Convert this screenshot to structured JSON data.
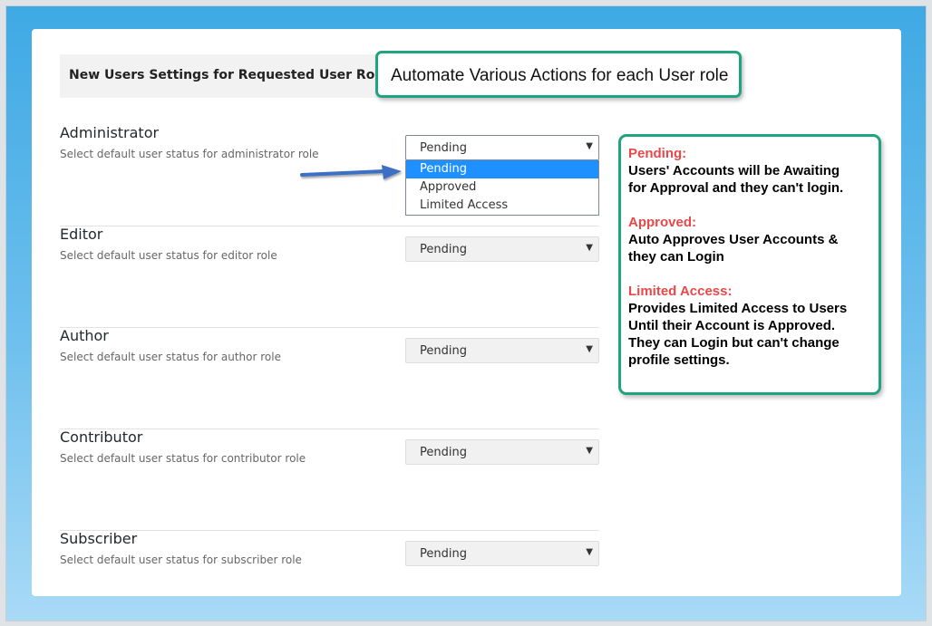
{
  "header": {
    "title": "New Users Settings for Requested User Role"
  },
  "callout": {
    "text": "Automate Various Actions for each User role"
  },
  "roles": [
    {
      "title": "Administrator",
      "description": "Select default user status for administrator role",
      "selected": "Pending"
    },
    {
      "title": "Editor",
      "description": "Select default user status for editor role",
      "selected": "Pending"
    },
    {
      "title": "Author",
      "description": "Select default user status for author role",
      "selected": "Pending"
    },
    {
      "title": "Contributor",
      "description": "Select default user status for contributor role",
      "selected": "Pending"
    },
    {
      "title": "Subscriber",
      "description": "Select default user status for subscriber role",
      "selected": "Pending"
    }
  ],
  "dropdown": {
    "options": [
      "Pending",
      "Approved",
      "Limited Access"
    ],
    "highlighted": "Pending"
  },
  "info": {
    "pending_heading": "Pending:",
    "pending_lines": [
      "Users' Accounts will be Awaiting",
      "for Approval and they can't login."
    ],
    "approved_heading": "Approved:",
    "approved_lines": [
      "Auto Approves User Accounts &",
      "they can Login"
    ],
    "limited_heading": "Limited Access:",
    "limited_lines": [
      "Provides Limited Access to Users",
      "Until their Account is Approved.",
      "They can Login but can't change",
      "profile settings."
    ]
  },
  "icons": {
    "caret": "caret-down-icon",
    "arrow": "arrow-right-icon"
  },
  "colors": {
    "accent_border": "#1fa47f",
    "heading_red": "#e8484a",
    "selected_option": "#1e90ff",
    "arrow_blue": "#3b6fc4"
  }
}
